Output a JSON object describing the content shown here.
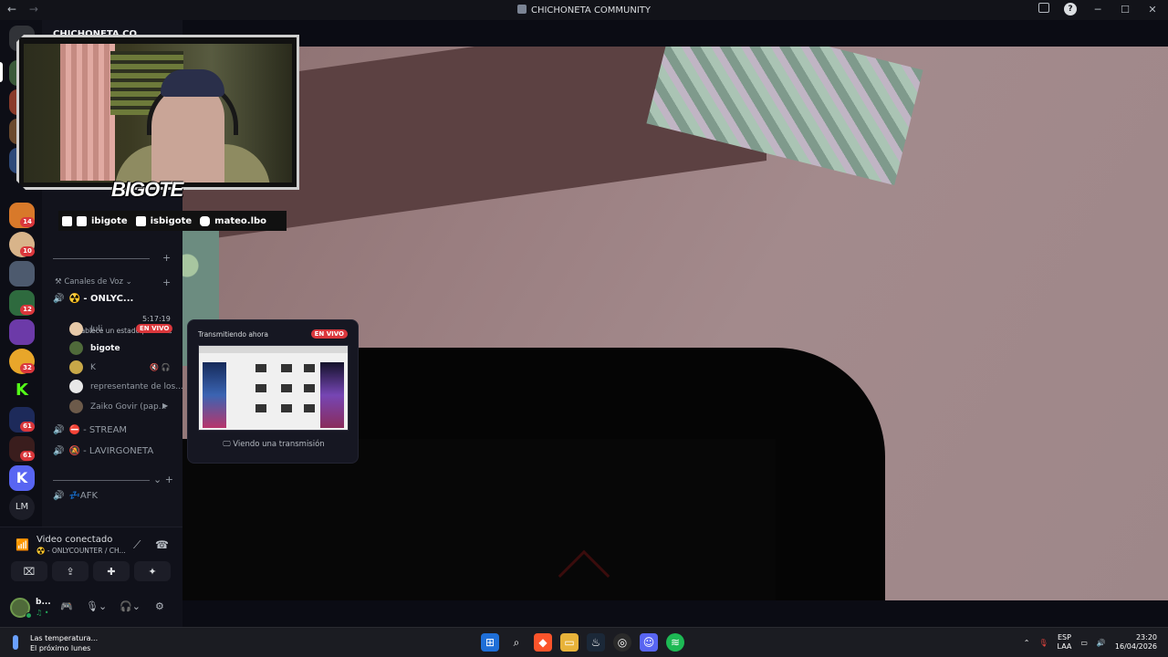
{
  "window": {
    "title": "CHICHONETA COMMUNITY",
    "back": "←",
    "forward": "→"
  },
  "server_rail": {
    "badges": [
      "14",
      "10",
      "12",
      "32",
      "61",
      "61"
    ],
    "initials": "LM"
  },
  "channel_list": {
    "server_name": "CHICHONETA CO",
    "voice_category": "Canales de Voz",
    "active_channel": {
      "name": "☢️ - ONLYC...",
      "timer": "5:17:19",
      "status_hint": "Establece un estado para el..."
    },
    "members": [
      {
        "name": "Juli",
        "live": "EN VIVO"
      },
      {
        "name": "bigote"
      },
      {
        "name": "K"
      },
      {
        "name": "representante de los..."
      },
      {
        "name": "Zaiko Govir (pap..."
      }
    ],
    "channels": [
      {
        "name": "⛔ - STREAM"
      },
      {
        "name": "🔕 - LAVIRGONETA"
      },
      {
        "name": "💤AFK"
      }
    ]
  },
  "voice_panel": {
    "title": "Video conectado",
    "subtitle": "☢️ - ONLYCOUNTER / CH...",
    "user": "b...",
    "user_status": "♫ •"
  },
  "overlay": {
    "brand": "BIGOTE",
    "socials": [
      "ibigote",
      "isbigote",
      "mateo.lbo"
    ]
  },
  "stream_popup": {
    "title": "Transmitiendo ahora",
    "live": "EN VIVO",
    "footer": "Viendo una transmisión"
  },
  "taskbar": {
    "weather_line1": "Las temperatura...",
    "weather_line2": "El próximo lunes",
    "lang_line1": "ESP",
    "lang_line2": "LAA",
    "time": "23:20",
    "date": "16/04/2026"
  },
  "colors": {
    "accent_red": "#da373c",
    "online_green": "#23a559",
    "discord_blurple": "#5865f2"
  }
}
